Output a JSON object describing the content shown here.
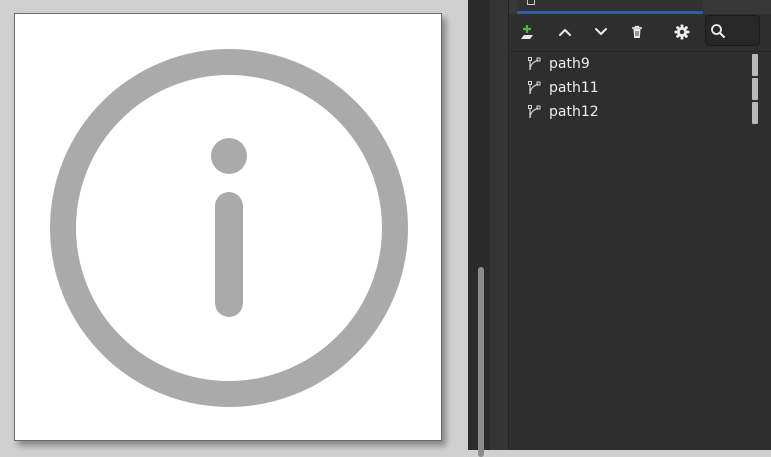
{
  "canvas": {
    "page_color": "#ffffff",
    "artwork_color": "#aaaaaa"
  },
  "layers_panel": {
    "toolbar": {
      "add_layer_icon": "add-layer-icon",
      "raise_icon": "chevron-up-icon",
      "lower_icon": "chevron-down-icon",
      "delete_icon": "trash-icon",
      "settings_icon": "gear-icon",
      "search_icon": "search-icon",
      "search_value": ""
    },
    "layers": [
      {
        "label": "path9",
        "icon": "path-icon"
      },
      {
        "label": "path11",
        "icon": "path-icon"
      },
      {
        "label": "path12",
        "icon": "path-icon"
      }
    ]
  }
}
